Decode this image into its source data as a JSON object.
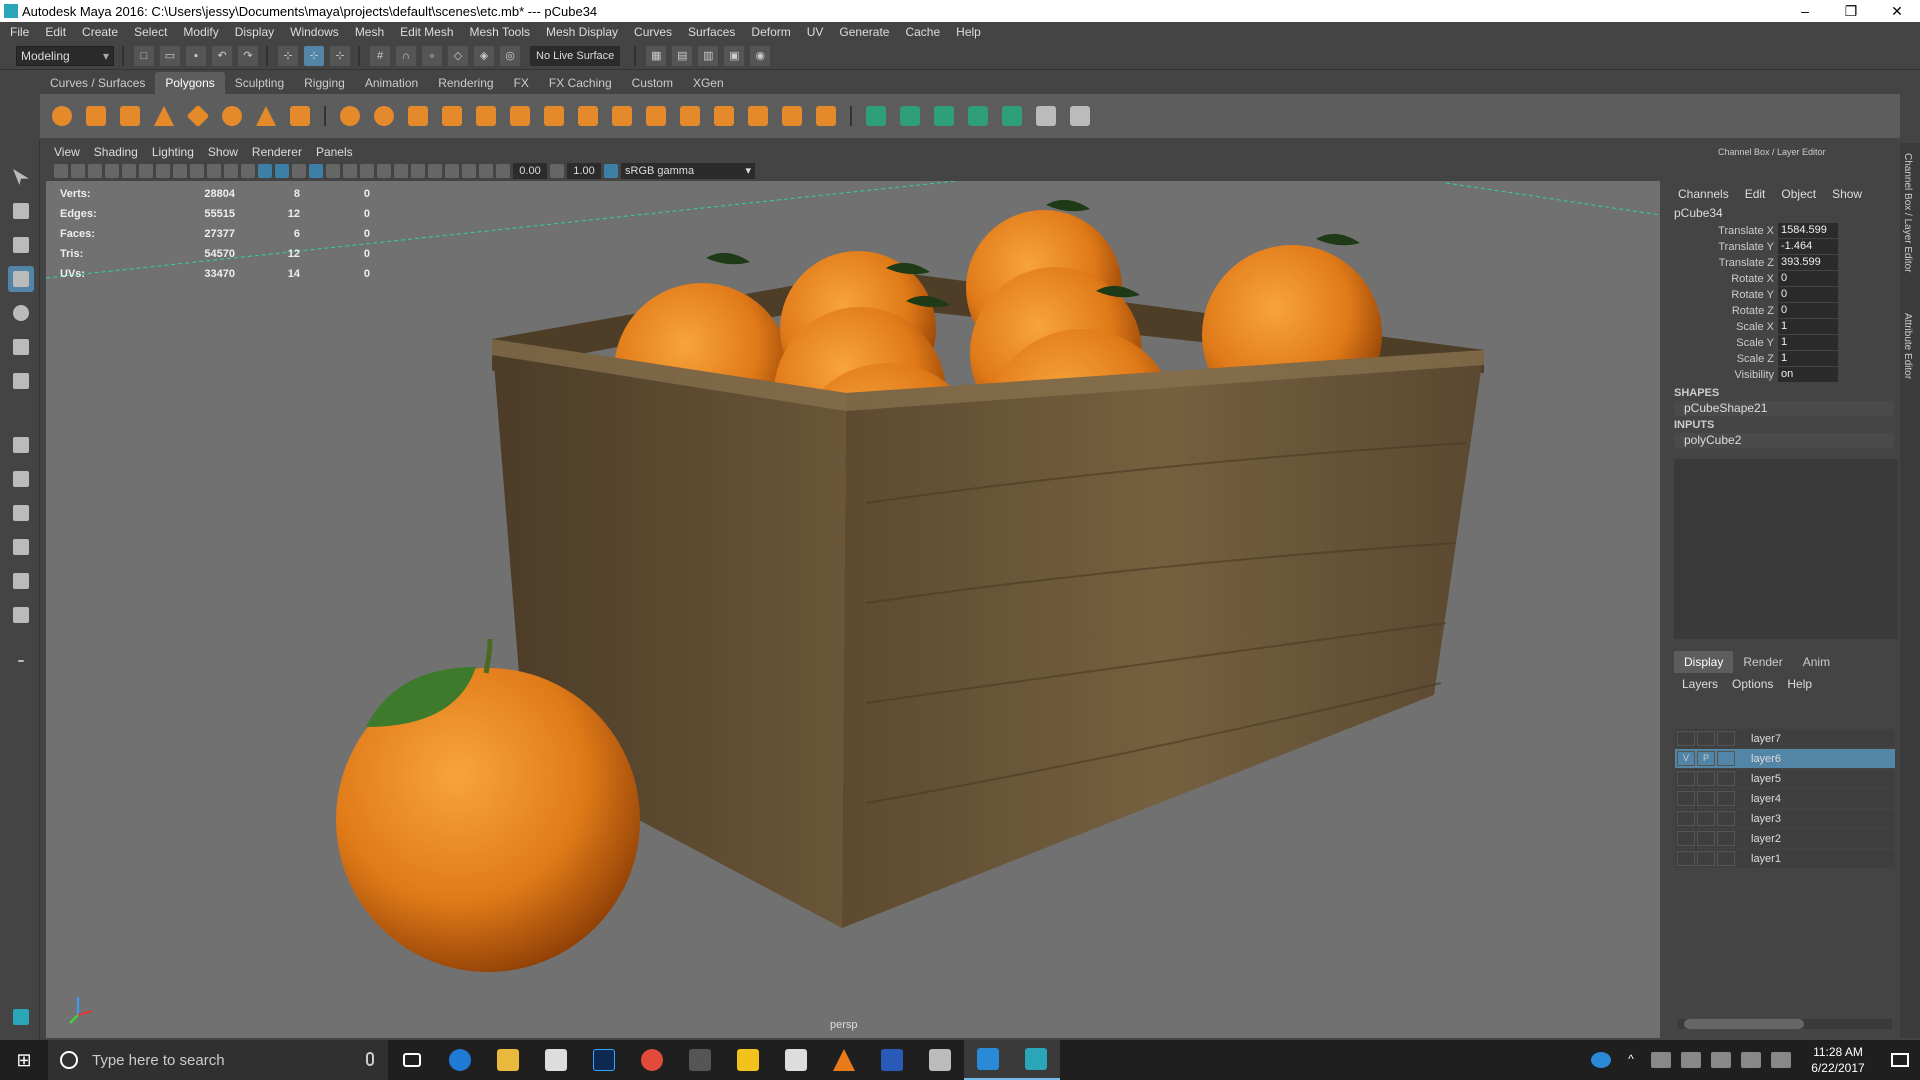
{
  "window": {
    "title": "Autodesk Maya 2016: C:\\Users\\jessy\\Documents\\maya\\projects\\default\\scenes\\etc.mb*   ---   pCube34",
    "min": "–",
    "max": "❐",
    "close": "✕"
  },
  "menubar": [
    "File",
    "Edit",
    "Create",
    "Select",
    "Modify",
    "Display",
    "Windows",
    "Mesh",
    "Edit Mesh",
    "Mesh Tools",
    "Mesh Display",
    "Curves",
    "Surfaces",
    "Deform",
    "UV",
    "Generate",
    "Cache",
    "Help"
  ],
  "statusline": {
    "mode": "Modeling",
    "live_surface": "No Live Surface"
  },
  "shelf": {
    "tabs": [
      "Curves / Surfaces",
      "Polygons",
      "Sculpting",
      "Rigging",
      "Animation",
      "Rendering",
      "FX",
      "FX Caching",
      "Custom",
      "XGen"
    ],
    "active_tab": "Polygons"
  },
  "viewport": {
    "menu": [
      "View",
      "Shading",
      "Lighting",
      "Show",
      "Renderer",
      "Panels"
    ],
    "exposure": "0.00",
    "gamma_value": "1.00",
    "color_space": "sRGB gamma",
    "camera": "persp",
    "hud": [
      {
        "label": "Verts:",
        "a": "28804",
        "b": "8",
        "c": "0"
      },
      {
        "label": "Edges:",
        "a": "55515",
        "b": "12",
        "c": "0"
      },
      {
        "label": "Faces:",
        "a": "27377",
        "b": "6",
        "c": "0"
      },
      {
        "label": "Tris:",
        "a": "54570",
        "b": "12",
        "c": "0"
      },
      {
        "label": "UVs:",
        "a": "33470",
        "b": "14",
        "c": "0"
      }
    ]
  },
  "channel_box": {
    "title": "Channel Box / Layer Editor",
    "menu": [
      "Channels",
      "Edit",
      "Object",
      "Show"
    ],
    "object": "pCube34",
    "attributes": [
      {
        "name": "Translate X",
        "value": "1584.599"
      },
      {
        "name": "Translate Y",
        "value": "-1.464"
      },
      {
        "name": "Translate Z",
        "value": "393.599"
      },
      {
        "name": "Rotate X",
        "value": "0"
      },
      {
        "name": "Rotate Y",
        "value": "0"
      },
      {
        "name": "Rotate Z",
        "value": "0"
      },
      {
        "name": "Scale X",
        "value": "1"
      },
      {
        "name": "Scale Y",
        "value": "1"
      },
      {
        "name": "Scale Z",
        "value": "1"
      },
      {
        "name": "Visibility",
        "value": "on"
      }
    ],
    "shapes_header": "SHAPES",
    "shape": "pCubeShape21",
    "inputs_header": "INPUTS",
    "input": "polyCube2"
  },
  "layer_editor": {
    "tabs": [
      "Display",
      "Render",
      "Anim"
    ],
    "active_tab": "Display",
    "menu": [
      "Layers",
      "Options",
      "Help"
    ],
    "layers": [
      "layer7",
      "layer6",
      "layer5",
      "layer4",
      "layer3",
      "layer2",
      "layer1"
    ],
    "selected": "layer6",
    "v_label": "V",
    "p_label": "P"
  },
  "side_tabs": [
    "Channel Box / Layer Editor",
    "Attribute Editor"
  ],
  "taskbar": {
    "search_placeholder": "Type here to search",
    "time": "11:28 AM",
    "date": "6/22/2017"
  },
  "colors": {
    "accent": "#5285a6",
    "orange": "#e48a2a",
    "crate": "#6a5638",
    "viewport_bg": "#717171"
  }
}
